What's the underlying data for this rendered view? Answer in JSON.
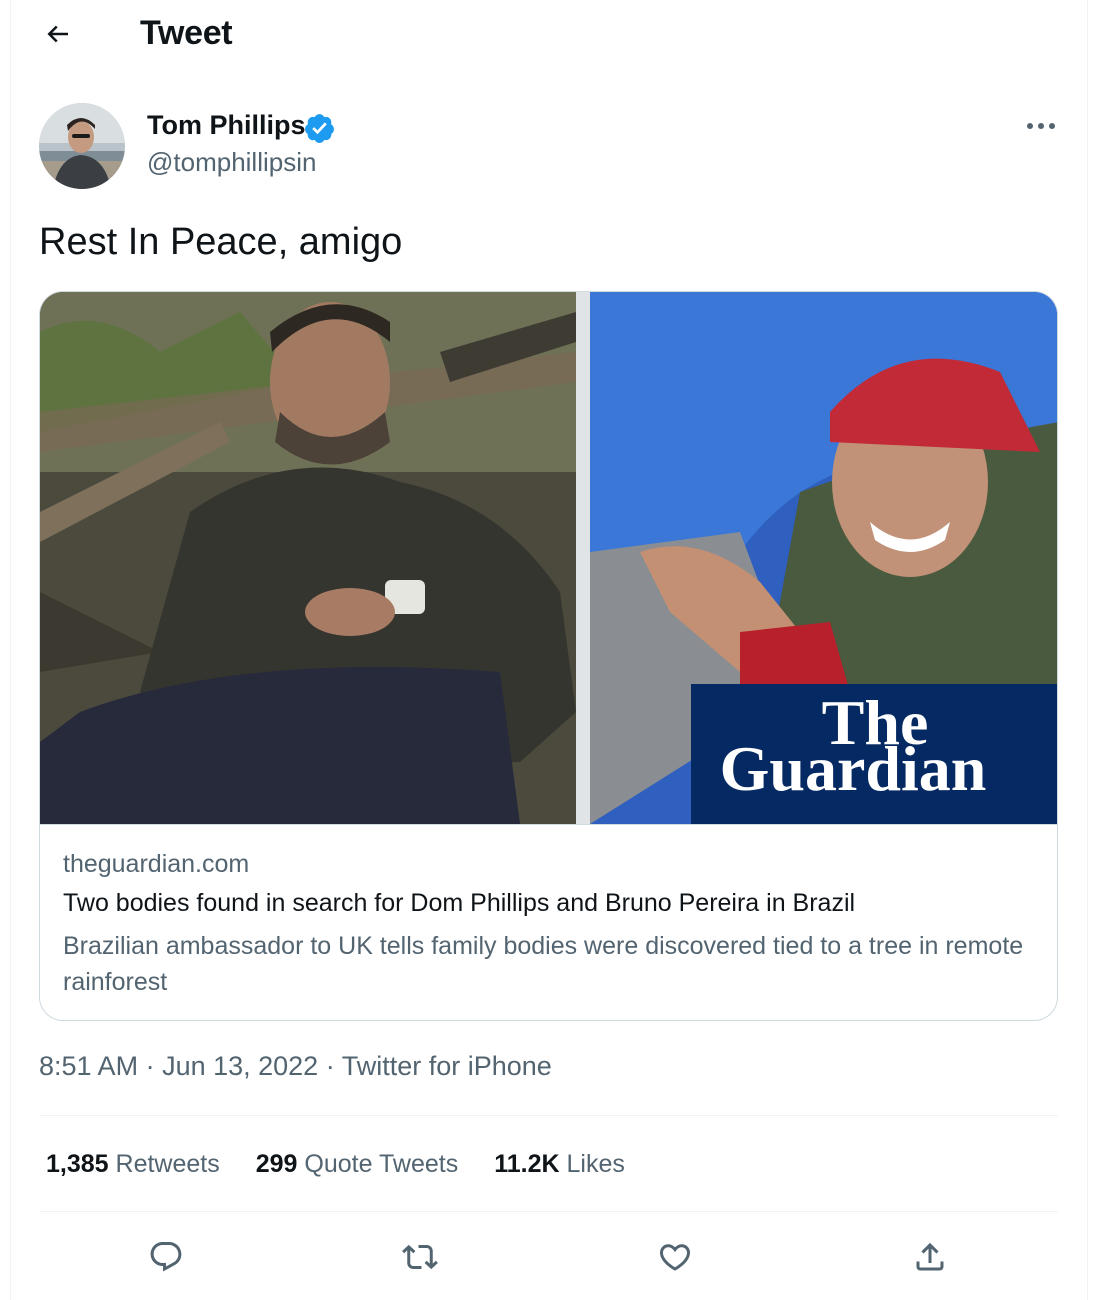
{
  "header": {
    "title": "Tweet",
    "back_icon": "arrow-left-icon"
  },
  "author": {
    "name": "Tom Phillips",
    "handle": "@tomphillipsin",
    "verified_icon": "verified-badge-icon",
    "verified_color": "#1d9bf0",
    "more_icon": "more-horizontal-icon"
  },
  "tweet": {
    "text": "Rest In Peace, amigo"
  },
  "card": {
    "logo_line1": "The",
    "logo_line2": "Guardian",
    "logo_bg": "#052962",
    "domain": "theguardian.com",
    "title": "Two bodies found in search for Dom Phillips and Bruno Pereira in Brazil",
    "description": "Brazilian ambassador to UK tells family bodies were discovered tied to a tree in remote rainforest"
  },
  "meta": {
    "time": "8:51 AM",
    "sep1": " · ",
    "date": "Jun 13, 2022",
    "sep2": " · ",
    "source": "Twitter for iPhone"
  },
  "stats": {
    "retweets_count": "1,385",
    "retweets_label": "Retweets",
    "quotes_count": "299",
    "quotes_label": "Quote Tweets",
    "likes_count": "11.2K",
    "likes_label": "Likes"
  },
  "actions": [
    "reply-icon",
    "retweet-icon",
    "like-icon",
    "share-icon"
  ],
  "colors": {
    "text": "#0f1419",
    "secondary": "#536471",
    "border": "#cfd9de"
  }
}
